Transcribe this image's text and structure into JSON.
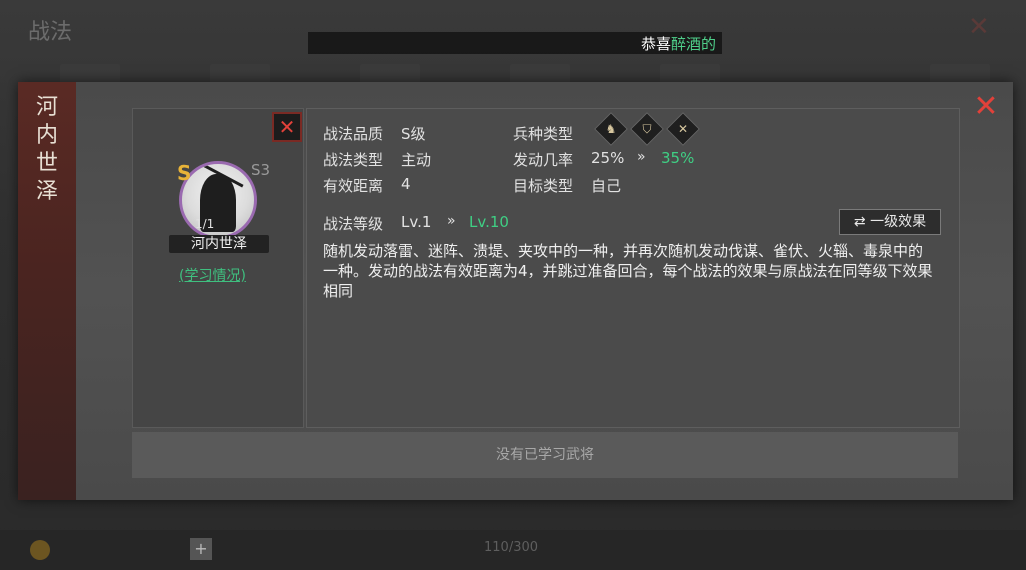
{
  "background": {
    "title": "战法",
    "marquee": {
      "prefix": "恭喜",
      "highlight": "醉酒的"
    },
    "page_indicator": "110/300"
  },
  "dialog": {
    "general_vertical_name": "河内世泽",
    "left": {
      "grade": "S",
      "season": "S3",
      "count": "1/1",
      "name": "河内世泽",
      "learn_link": "(学习情况)"
    },
    "stats": {
      "quality_label": "战法品质",
      "quality_value": "S级",
      "type_label": "战法类型",
      "type_value": "主动",
      "range_label": "有效距离",
      "range_value": "4",
      "troop_label": "兵种类型",
      "rate_label": "发动几率",
      "rate_from": "25%",
      "rate_to": "35%",
      "target_label": "目标类型",
      "target_value": "自己",
      "level_label": "战法等级",
      "level_from": "Lv.1",
      "level_to": "Lv.10",
      "arrow": "»"
    },
    "effect_button": "⇄ 一级效果",
    "description": "随机发动落雷、迷阵、溃堤、夹攻中的一种，并再次随机发动伐谋、雀伏、火辎、毒泉中的一种。发动的战法有效距离为4，并跳过准备回合，每个战法的效果与原战法在同等级下效果相同",
    "no_learned": "没有已学习武将"
  },
  "icons": {
    "troop_1": "cavalry-icon",
    "troop_2": "shield-icon",
    "troop_3": "bow-icon",
    "close": "close-icon"
  },
  "colors": {
    "accent_green": "#3fcf84",
    "close_red": "#e2413a",
    "grade_gold": "#e8b338"
  }
}
